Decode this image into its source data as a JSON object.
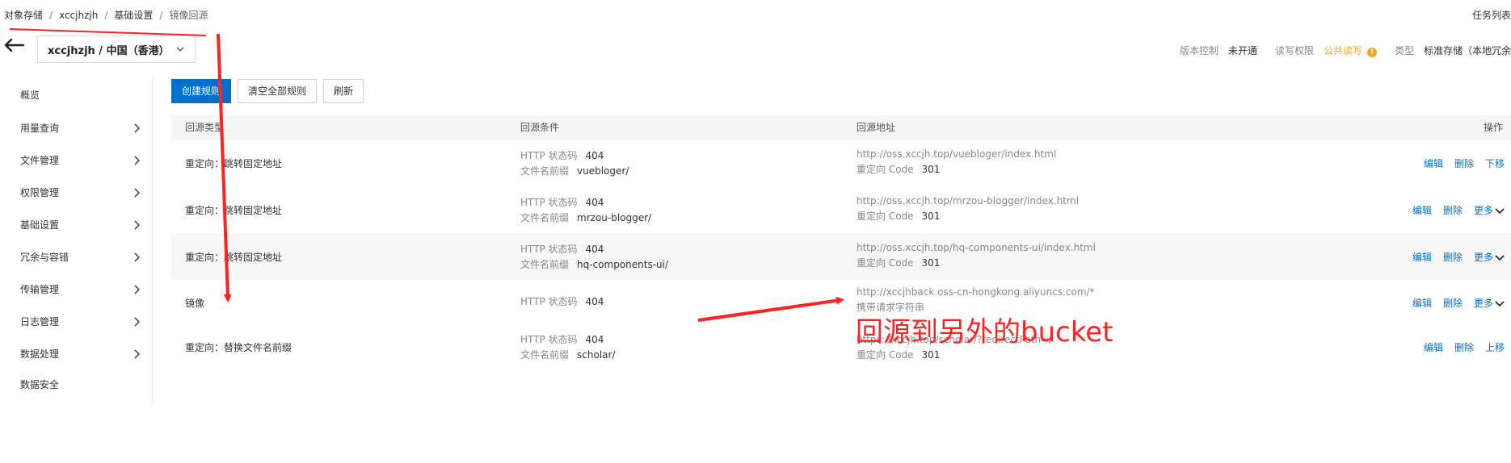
{
  "breadcrumb": [
    "对象存储",
    "xccjhzjh",
    "基础设置",
    "镜像回源"
  ],
  "task_list": "任务列表",
  "bucket_select": "xccjhzjh / 中国（香港）",
  "meta": {
    "version_label": "版本控制",
    "version_value": "未开通",
    "acl_label": "读写权限",
    "acl_value": "公共读写",
    "type_label": "类型",
    "type_value": "标准存储（本地冗余）"
  },
  "sidebar": [
    {
      "label": "概览",
      "has_children": false
    },
    {
      "label": "用量查询",
      "has_children": true
    },
    {
      "label": "文件管理",
      "has_children": true
    },
    {
      "label": "权限管理",
      "has_children": true
    },
    {
      "label": "基础设置",
      "has_children": true
    },
    {
      "label": "冗余与容错",
      "has_children": true
    },
    {
      "label": "传输管理",
      "has_children": true
    },
    {
      "label": "日志管理",
      "has_children": true
    },
    {
      "label": "数据处理",
      "has_children": true
    },
    {
      "label": "数据安全",
      "has_children": false
    }
  ],
  "toolbar": {
    "create_label": "创建规则",
    "clear_label": "清空全部规则",
    "refresh_label": "刷新"
  },
  "table": {
    "headers": {
      "type": "回源类型",
      "condition": "回源条件",
      "address": "回源地址",
      "ops": "操作"
    },
    "rows": [
      {
        "type": "重定向：跳转固定地址",
        "cond": [
          {
            "k": "HTTP 状态码",
            "v": "404"
          },
          {
            "k": "文件名前缀",
            "v": "vuebloger/"
          }
        ],
        "addr": [
          {
            "k": "http://oss.xccjh.top/vuebloger/index.html",
            "v": ""
          },
          {
            "k": "重定向 Code",
            "v": "301"
          }
        ],
        "ops": [
          "编辑",
          "删除",
          "下移"
        ]
      },
      {
        "type": "重定向：跳转固定地址",
        "cond": [
          {
            "k": "HTTP 状态码",
            "v": "404"
          },
          {
            "k": "文件名前缀",
            "v": "mrzou-blogger/"
          }
        ],
        "addr": [
          {
            "k": "http://oss.xccjh.top/mrzou-blogger/index.html",
            "v": ""
          },
          {
            "k": "重定向 Code",
            "v": "301"
          }
        ],
        "ops": [
          "编辑",
          "删除",
          "更多"
        ]
      },
      {
        "type": "重定向：跳转固定地址",
        "cond": [
          {
            "k": "HTTP 状态码",
            "v": "404"
          },
          {
            "k": "文件名前缀",
            "v": "hq-components-ui/"
          }
        ],
        "addr": [
          {
            "k": "http://oss.xccjh.top/hq-components-ui/index.html",
            "v": ""
          },
          {
            "k": "重定向 Code",
            "v": "301"
          }
        ],
        "ops": [
          "编辑",
          "删除",
          "更多"
        ]
      },
      {
        "type": "镜像",
        "cond": [
          {
            "k": "HTTP 状态码",
            "v": "404"
          }
        ],
        "addr": [
          {
            "k": "http://xccjhback.oss-cn-hongkong.aliyuncs.com/*",
            "v": ""
          },
          {
            "k": "携带请求字符串",
            "v": ""
          }
        ],
        "ops": [
          "编辑",
          "删除",
          "更多"
        ]
      },
      {
        "type": "重定向：替换文件名前缀",
        "cond": [
          {
            "k": "HTTP 状态码",
            "v": "404"
          },
          {
            "k": "文件名前缀",
            "v": "scholar/"
          }
        ],
        "addr": [
          {
            "k": "https://xccjh.top/scholar/?redirectPath=/",
            "v": ""
          },
          {
            "k": "重定向 Code",
            "v": "301"
          }
        ],
        "ops": [
          "编辑",
          "删除",
          "上移"
        ]
      }
    ]
  },
  "annotation": "回源到另外的bucket",
  "colors": {
    "primary": "#0070cc",
    "annotation": "#ff2222",
    "warning": "#f5a623"
  }
}
